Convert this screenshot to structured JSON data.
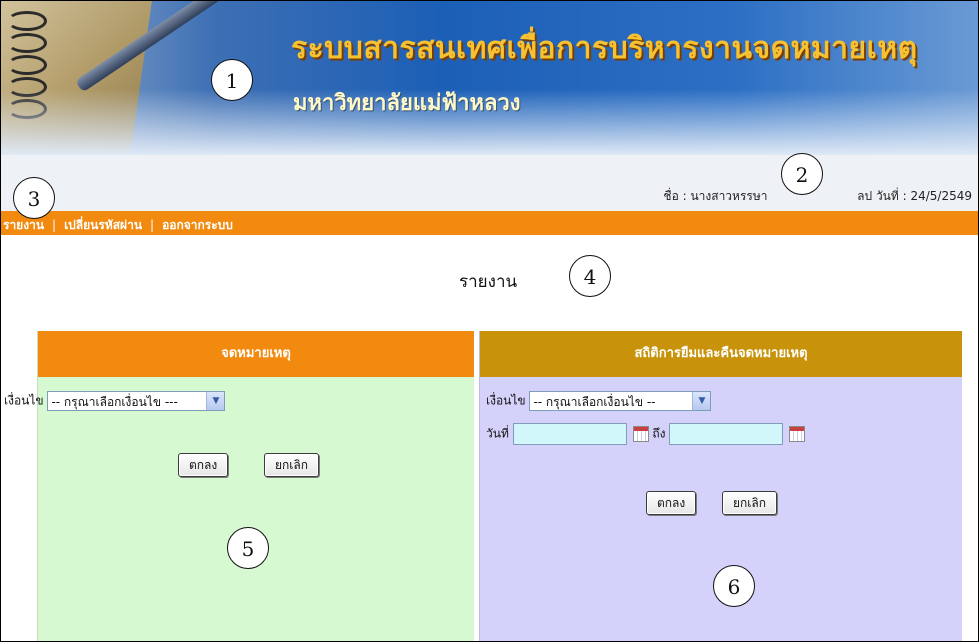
{
  "header": {
    "title": "ระบบสารสนเทศเพื่อการบริหารงานจดหมายเหตุ",
    "subtitle": "มหาวิทยาลัยแม่ฟ้าหลวง"
  },
  "user_info": {
    "prefix": "ชื่อ : นางสาวหรรษา",
    "suffix": "ลป  วันที่ : 24/5/2549"
  },
  "menu": {
    "items": [
      {
        "label": "รายงาน"
      },
      {
        "label": "เปลี่ยนรหัสผ่าน"
      },
      {
        "label": "ออกจากระบบ"
      }
    ],
    "separator": "|"
  },
  "page": {
    "heading": "รายงาน"
  },
  "left_panel": {
    "header": "จดหมายเหตุ",
    "condition_label": "เงื่อนไข",
    "condition_select": "-- กรุณาเลือกเงื่อนไข ---",
    "ok_label": "ตกลง",
    "cancel_label": "ยกเลิก"
  },
  "right_panel": {
    "header": "สถิติการยืมและคืนจดหมายเหตุ",
    "condition_label": "เงื่อนไข",
    "condition_select": "-- กรุณาเลือกเงื่อนไข --",
    "date_label": "วันที่",
    "to_label": "ถึง",
    "date_from": "",
    "date_to": "",
    "ok_label": "ตกลง",
    "cancel_label": "ยกเลิก"
  },
  "callouts": [
    "1",
    "2",
    "3",
    "4",
    "5",
    "6"
  ],
  "colors": {
    "menu_bar": "#f28a10",
    "left_panel_bg": "#d7f9d2",
    "right_panel_bg": "#d4d2fb",
    "right_panel_header": "#c8930a",
    "title_gold": "#f6c232"
  },
  "icons": {
    "select_arrow": "chevron-down-icon",
    "calendar": "calendar-icon"
  }
}
